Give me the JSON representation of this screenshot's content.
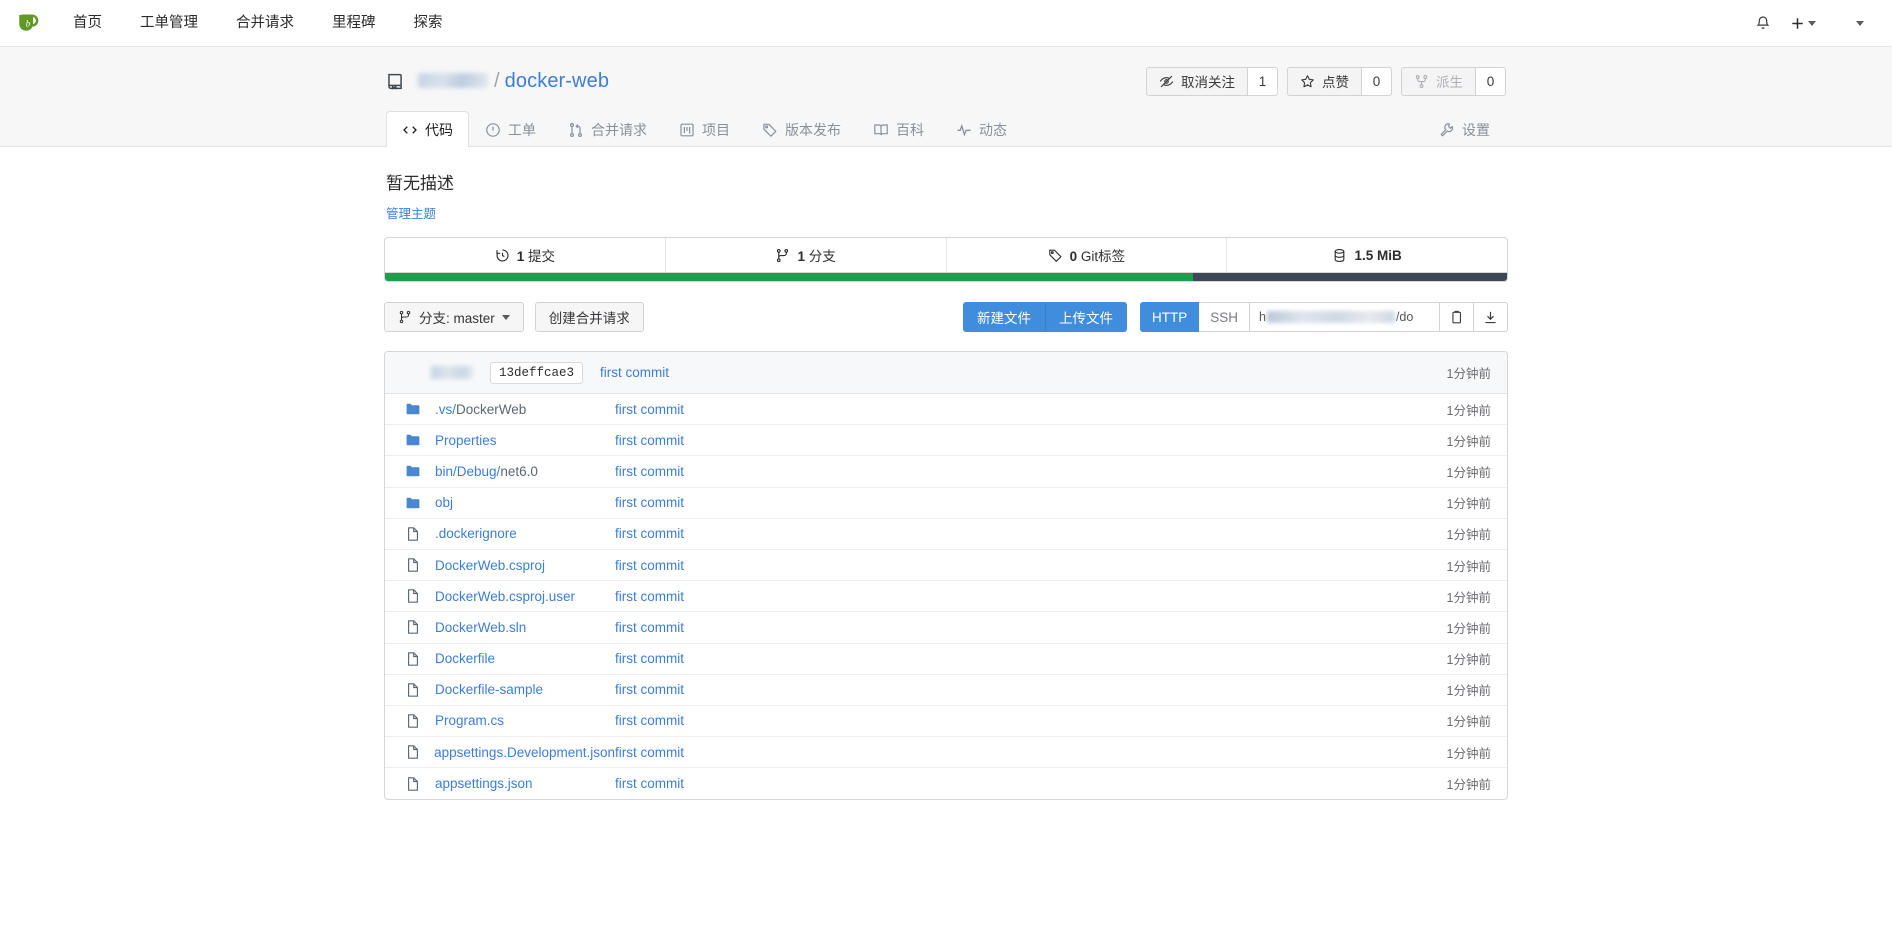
{
  "navbar": {
    "logo_icon": "gitea-logo-icon",
    "items": [
      {
        "label": "首页",
        "name": "nav-item-dashboard"
      },
      {
        "label": "工单管理",
        "name": "nav-item-issues"
      },
      {
        "label": "合并请求",
        "name": "nav-item-pull-requests"
      },
      {
        "label": "里程碑",
        "name": "nav-item-milestones"
      },
      {
        "label": "探索",
        "name": "nav-item-explore"
      }
    ],
    "notification_icon": "bell-icon",
    "create_icon": "plus-icon",
    "user_menu_icon": "chevron-down-icon"
  },
  "repo": {
    "icon": "repository-icon",
    "owner_redacted": "",
    "separator": "/",
    "name": "docker-web",
    "actions": [
      {
        "label": "取消关注",
        "count": "1",
        "icon": "eye-slash-icon",
        "name": "unwatch-button",
        "disabled": false
      },
      {
        "label": "点赞",
        "count": "0",
        "icon": "star-icon",
        "name": "star-button",
        "disabled": false
      },
      {
        "label": "派生",
        "count": "0",
        "icon": "fork-icon",
        "name": "fork-button",
        "disabled": true
      }
    ],
    "tabs": [
      {
        "label": "代码",
        "icon": "code-icon",
        "name": "tab-code",
        "active": true
      },
      {
        "label": "工单",
        "icon": "issue-icon",
        "name": "tab-issues",
        "active": false
      },
      {
        "label": "合并请求",
        "icon": "pull-request-icon",
        "name": "tab-pull-requests",
        "active": false
      },
      {
        "label": "项目",
        "icon": "project-icon",
        "name": "tab-projects",
        "active": false
      },
      {
        "label": "版本发布",
        "icon": "tag-icon",
        "name": "tab-releases",
        "active": false
      },
      {
        "label": "百科",
        "icon": "book-icon",
        "name": "tab-wiki",
        "active": false
      },
      {
        "label": "动态",
        "icon": "pulse-icon",
        "name": "tab-activity",
        "active": false
      }
    ],
    "settings": {
      "label": "设置",
      "icon": "wrench-icon"
    }
  },
  "description": {
    "text": "暂无描述",
    "topics_link": "管理主题"
  },
  "stats": [
    {
      "icon": "clock-icon",
      "count": "1",
      "label": "提交",
      "name": "stat-commits"
    },
    {
      "icon": "branch-icon",
      "count": "1",
      "label": "分支",
      "name": "stat-branches"
    },
    {
      "icon": "tag-icon",
      "count": "0",
      "label": "Git标签",
      "name": "stat-tags"
    },
    {
      "icon": "database-icon",
      "count": "1.5 MiB",
      "label": "",
      "name": "stat-size"
    }
  ],
  "language_bar": [
    {
      "color": "#1e9e4a",
      "width": "72%"
    },
    {
      "color": "#3c4858",
      "width": "28%"
    }
  ],
  "toolbar": {
    "branch_label": "分支: master",
    "branch_icon": "branch-icon",
    "pull_request_label": "创建合并请求",
    "new_file_label": "新建文件",
    "upload_file_label": "上传文件",
    "protocol_http": "HTTP",
    "protocol_ssh": "SSH",
    "clone_url_prefix": "h",
    "clone_url_suffix": "/do",
    "copy_icon": "clipboard-icon",
    "download_icon": "download-icon"
  },
  "commit_header": {
    "sha": "13deffcae3",
    "message": "first commit",
    "age": "1分钟前"
  },
  "files": [
    {
      "type": "folder",
      "name": ".vs/DockerWeb",
      "message": "first commit",
      "age": "1分钟前"
    },
    {
      "type": "folder",
      "name": "Properties",
      "message": "first commit",
      "age": "1分钟前"
    },
    {
      "type": "folder",
      "name": "bin/Debug/net6.0",
      "message": "first commit",
      "age": "1分钟前"
    },
    {
      "type": "folder",
      "name": "obj",
      "message": "first commit",
      "age": "1分钟前"
    },
    {
      "type": "file",
      "name": ".dockerignore",
      "message": "first commit",
      "age": "1分钟前"
    },
    {
      "type": "file",
      "name": "DockerWeb.csproj",
      "message": "first commit",
      "age": "1分钟前"
    },
    {
      "type": "file",
      "name": "DockerWeb.csproj.user",
      "message": "first commit",
      "age": "1分钟前"
    },
    {
      "type": "file",
      "name": "DockerWeb.sln",
      "message": "first commit",
      "age": "1分钟前"
    },
    {
      "type": "file",
      "name": "Dockerfile",
      "message": "first commit",
      "age": "1分钟前"
    },
    {
      "type": "file",
      "name": "Dockerfile-sample",
      "message": "first commit",
      "age": "1分钟前"
    },
    {
      "type": "file",
      "name": "Program.cs",
      "message": "first commit",
      "age": "1分钟前"
    },
    {
      "type": "file",
      "name": "appsettings.Development.json",
      "message": "first commit",
      "age": "1分钟前"
    },
    {
      "type": "file",
      "name": "appsettings.json",
      "message": "first commit",
      "age": "1分钟前"
    }
  ],
  "colors": {
    "accent_blue": "#3f8ddc",
    "link_blue": "#3b7dd8",
    "logo_green": "#609926",
    "lang_green": "#1e9e4a"
  }
}
